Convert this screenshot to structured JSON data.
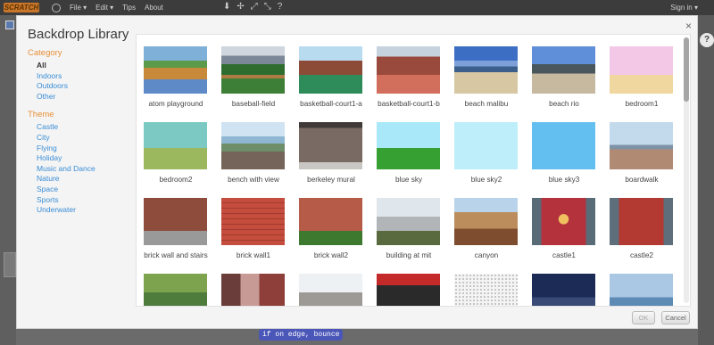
{
  "app": {
    "logo_text": "SCRATCH",
    "menu": [
      "File ▾",
      "Edit ▾",
      "Tips",
      "About"
    ],
    "sign_in": "Sign in ▾",
    "help_icon": "?",
    "bottom_block_text": "if on edge, bounce"
  },
  "dialog": {
    "title": "Backdrop Library",
    "close_label": "×",
    "category_title": "Category",
    "categories": [
      "All",
      "Indoors",
      "Outdoors",
      "Other"
    ],
    "theme_title": "Theme",
    "themes": [
      "Castle",
      "City",
      "Flying",
      "Holiday",
      "Music and Dance",
      "Nature",
      "Space",
      "Sports",
      "Underwater"
    ],
    "ok_label": "OK",
    "cancel_label": "Cancel",
    "items": [
      {
        "label": "atom playground",
        "art": "t-atom"
      },
      {
        "label": "baseball-field",
        "art": "t-baseball"
      },
      {
        "label": "basketball-court1-a",
        "art": "t-bcourt-a"
      },
      {
        "label": "basketball-court1-b",
        "art": "t-bcourt-b"
      },
      {
        "label": "beach malibu",
        "art": "t-malibu"
      },
      {
        "label": "beach rio",
        "art": "t-rio"
      },
      {
        "label": "bedroom1",
        "art": "t-bedroom1"
      },
      {
        "label": "bedroom2",
        "art": "t-bedroom2"
      },
      {
        "label": "bench with view",
        "art": "t-bench"
      },
      {
        "label": "berkeley mural",
        "art": "t-berkeley"
      },
      {
        "label": "blue sky",
        "art": "t-bluesky"
      },
      {
        "label": "blue sky2",
        "art": "t-bluesky2"
      },
      {
        "label": "blue sky3",
        "art": "t-bluesky3"
      },
      {
        "label": "boardwalk",
        "art": "t-boardwalk"
      },
      {
        "label": "brick wall and stairs",
        "art": "t-brickstairs"
      },
      {
        "label": "brick wall1",
        "art": "t-brick1"
      },
      {
        "label": "brick wall2",
        "art": "t-brick2"
      },
      {
        "label": "building at mit",
        "art": "t-mit"
      },
      {
        "label": "canyon",
        "art": "t-canyon"
      },
      {
        "label": "castle1",
        "art": "t-castle1"
      },
      {
        "label": "castle2",
        "art": "t-castle2"
      },
      {
        "label": "",
        "art": "t-r5a"
      },
      {
        "label": "",
        "art": "t-r5b"
      },
      {
        "label": "",
        "art": "t-r5c"
      },
      {
        "label": "",
        "art": "t-r5d"
      },
      {
        "label": "",
        "art": "t-r5e"
      },
      {
        "label": "",
        "art": "t-r5f"
      },
      {
        "label": "",
        "art": "t-r5g"
      }
    ]
  }
}
